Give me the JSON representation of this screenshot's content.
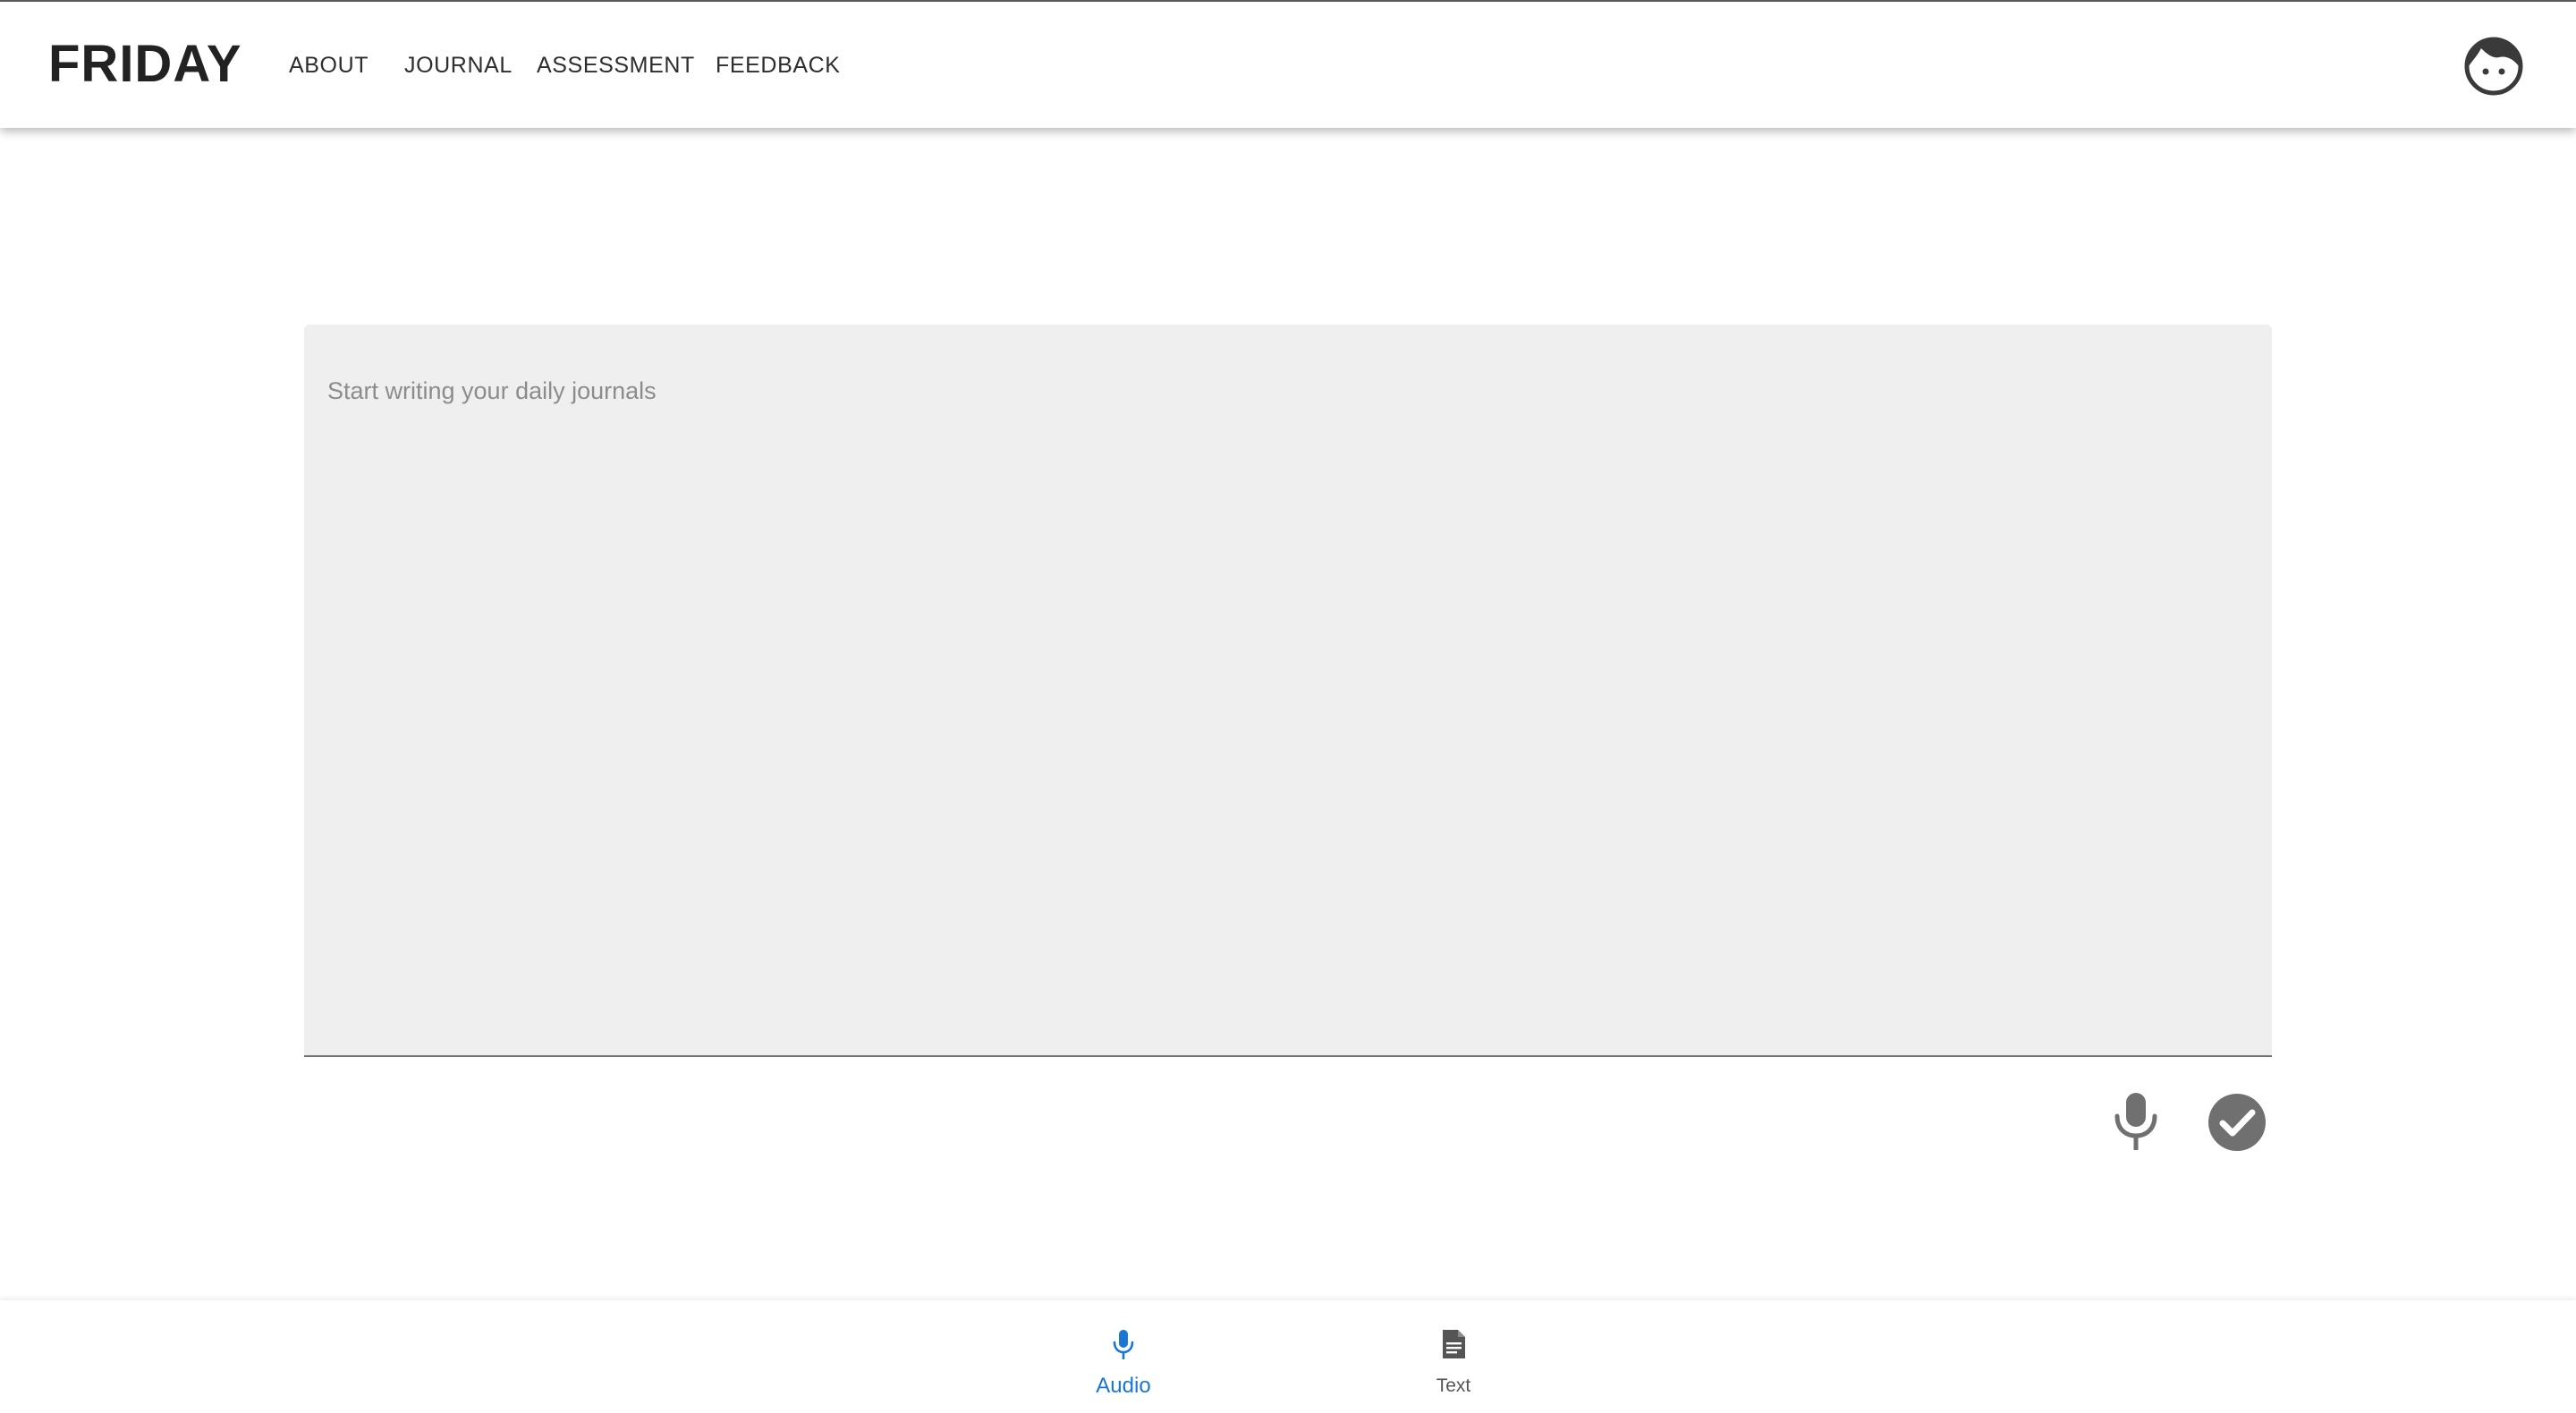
{
  "header": {
    "brand": "FRIDAY",
    "nav": [
      {
        "label": "ABOUT"
      },
      {
        "label": "JOURNAL"
      },
      {
        "label": "ASSESSMENT"
      },
      {
        "label": "FEEDBACK"
      }
    ],
    "avatar_icon": "face-avatar-icon"
  },
  "journal": {
    "value": "",
    "placeholder": "Start writing your daily journals"
  },
  "actions": {
    "mic_icon": "mic-icon",
    "submit_icon": "check-circle-icon"
  },
  "bottom_nav": {
    "selected": "Audio",
    "items": [
      {
        "label": "Audio",
        "icon": "mic-icon"
      },
      {
        "label": "Text",
        "icon": "document-icon"
      }
    ]
  },
  "colors": {
    "accent": "#1976d2",
    "text_field_bg": "#efefef",
    "icon_gray": "#707070"
  }
}
